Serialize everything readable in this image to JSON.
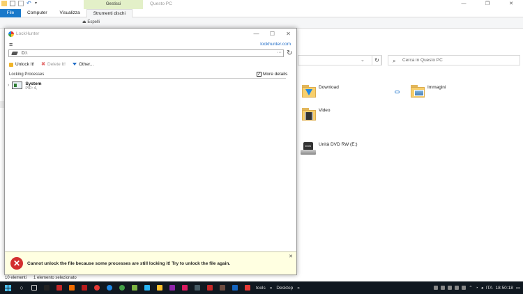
{
  "explorer": {
    "window_title": "Questo PC",
    "context_tab": "Gestisci",
    "tabs": [
      {
        "label": "File"
      },
      {
        "label": "Computer"
      },
      {
        "label": "Visualizza"
      },
      {
        "label": "Strumenti dischi"
      }
    ],
    "ribbon_item": "Espelli",
    "search_placeholder": "Cerca in Questo PC",
    "items": {
      "download": "Download",
      "immagini": "Immagini",
      "video": "Video",
      "dvd": "Unità DVD RW (E:)"
    },
    "status": {
      "count": "10 elementi",
      "selected": "1 elemento selezionato"
    }
  },
  "lockhunter": {
    "title": "LockHunter",
    "link": "lockhunter.com",
    "path": "D:\\",
    "toolbar": {
      "unlock": "Unlock It!",
      "delete": "Delete It!",
      "other": "Other..."
    },
    "section_label": "Locking Processes",
    "more_details": "More details",
    "process": {
      "name": "System",
      "pid": "PID: 4,"
    },
    "error": "Cannot unlock the file because some processes are still locking it! Try to unlock the file again."
  },
  "taskbar": {
    "toolbar_tools": "tools",
    "toolbar_desktop": "Desktop",
    "lang": "ITA",
    "time": "18:50:18"
  },
  "colors": {
    "accent": "#1979ca",
    "error_bg": "#ffffe1",
    "error_icon": "#d32f2f",
    "taskbar": "#101820"
  }
}
